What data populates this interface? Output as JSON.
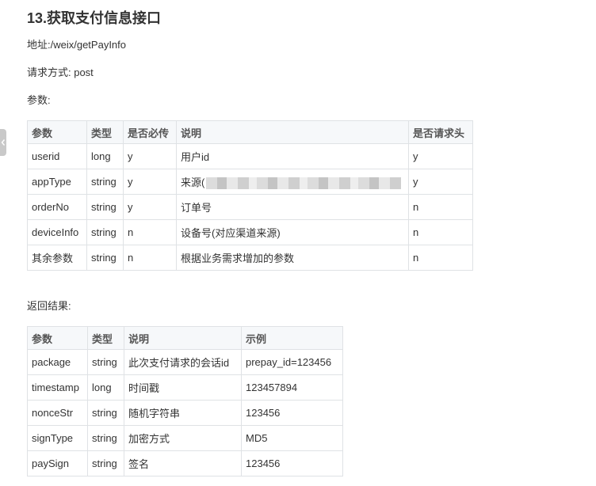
{
  "heading": "13.获取支付信息接口",
  "address_line": "地址:/weix/getPayInfo",
  "method_line": "请求方式: post",
  "params_label": "参数:",
  "params_table": {
    "headers": [
      "参数",
      "类型",
      "是否必传",
      "说明",
      "是否请求头"
    ],
    "rows": [
      [
        "userid",
        "long",
        "y",
        "用户id",
        "y"
      ],
      [
        "appType",
        "string",
        "y",
        "来源(",
        "y"
      ],
      [
        "orderNo",
        "string",
        "y",
        "订单号",
        "n"
      ],
      [
        "deviceInfo",
        "string",
        "n",
        "设备号(对应渠道来源)",
        "n"
      ],
      [
        "其余参数",
        "string",
        "n",
        "根据业务需求增加的参数",
        "n"
      ]
    ]
  },
  "return_label": "返回结果:",
  "return_table": {
    "headers": [
      "参数",
      "类型",
      "说明",
      "示例"
    ],
    "rows": [
      [
        "package",
        "string",
        "此次支付请求的会话id",
        "prepay_id=123456"
      ],
      [
        "timestamp",
        "long",
        "时间戳",
        "123457894"
      ],
      [
        "nonceStr",
        "string",
        "随机字符串",
        "123456"
      ],
      [
        "signType",
        "string",
        "加密方式",
        "MD5"
      ],
      [
        "paySign",
        "string",
        "签名",
        "123456"
      ]
    ]
  }
}
